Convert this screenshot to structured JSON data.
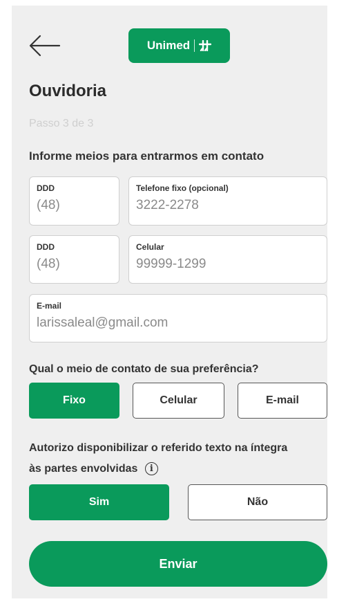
{
  "header": {
    "back_icon": "arrow-left-icon",
    "logo_text": "Unimed",
    "logo_icon": "unimed-symbol-icon"
  },
  "page": {
    "title": "Ouvidoria",
    "step": "Passo 3 de 3",
    "section_title": "Informe meios para entrarmos em contato"
  },
  "fields": {
    "ddd1": {
      "label": "DDD",
      "value": "(48)"
    },
    "landline": {
      "label": "Telefone fixo (opcional)",
      "value": "3222-2278"
    },
    "ddd2": {
      "label": "DDD",
      "value": "(48)"
    },
    "mobile": {
      "label": "Celular",
      "value": "99999-1299"
    },
    "email": {
      "label": "E-mail",
      "value": "larissaleal@gmail.com"
    }
  },
  "preference": {
    "question": "Qual o meio de contato de sua preferência?",
    "options": [
      "Fixo",
      "Celular",
      "E-mail"
    ],
    "selected": "Fixo"
  },
  "authorization": {
    "text_line1": "Autorizo disponibilizar o referido texto na íntegra",
    "text_line2": "às partes envolvidas",
    "info_icon": "info-icon",
    "options": [
      "Sim",
      "Não"
    ],
    "selected": "Sim"
  },
  "submit": {
    "label": "Enviar"
  },
  "colors": {
    "brand_green": "#0a9a5b",
    "background": "#efefef"
  }
}
